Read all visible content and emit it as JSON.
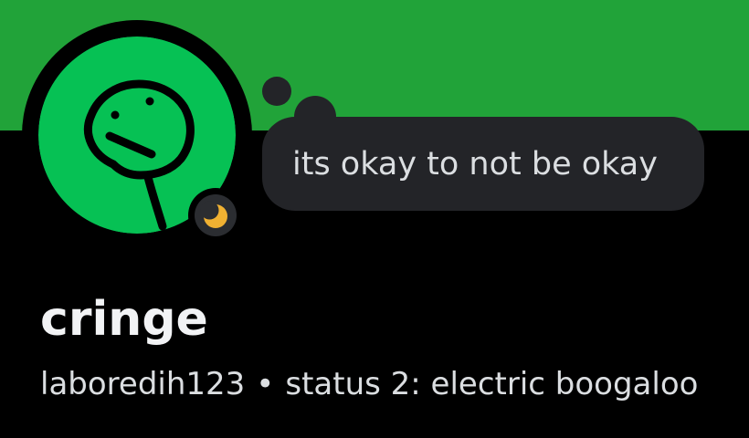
{
  "colors": {
    "banner": "#21a339",
    "avatar_background": "#06c154",
    "avatar_drawing": "#000000",
    "status_idle": "#f0b132",
    "bubble_background": "#232428",
    "page_background": "#000000",
    "text_primary": "#f2f3f5",
    "text_secondary": "#dbdee1"
  },
  "avatar": {
    "icon": "stick-figure-face-drawing"
  },
  "status": {
    "icon": "moon-icon",
    "state": "idle"
  },
  "custom_status": {
    "text": "its okay to not be okay"
  },
  "user": {
    "display_name": "cringe",
    "username": "laboredih123",
    "separator": "•",
    "pronouns_status": "status 2: electric boogaloo"
  }
}
